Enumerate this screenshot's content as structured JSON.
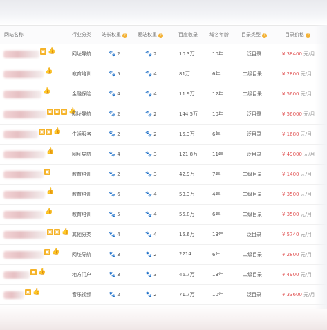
{
  "headers": {
    "site": "网站名称",
    "category": "行业分类",
    "weight1": "站长权重",
    "weight2": "爱站权重",
    "baidu": "百度收录",
    "age": "域名年龄",
    "dirtype": "目录类型",
    "price": "目录价格",
    "question_mark": "?"
  },
  "rows": [
    {
      "category": "网址导航",
      "w1": "2",
      "w2": "2",
      "baidu": "10.3万",
      "age": "10年",
      "dirtype": "泛目录",
      "price": "¥ 38400",
      "unit": " 元/月",
      "site_w": 52,
      "badges": [
        "hot"
      ],
      "thumbs": 1
    },
    {
      "category": "教育培训",
      "w1": "5",
      "w2": "4",
      "baidu": "81万",
      "age": "6年",
      "dirtype": "二级目录",
      "price": "¥ 2800",
      "unit": " 元/月",
      "site_w": 58,
      "badges": [],
      "thumbs": 1
    },
    {
      "category": "金融保险",
      "w1": "4",
      "w2": "4",
      "baidu": "11.9万",
      "age": "12年",
      "dirtype": "二级目录",
      "price": "¥ 5600",
      "unit": " 元/月",
      "site_w": 55,
      "badges": [],
      "thumbs": 1
    },
    {
      "category": "网址导航",
      "w1": "2",
      "w2": "2",
      "baidu": "144.5万",
      "age": "10年",
      "dirtype": "泛目录",
      "price": "¥ 56000",
      "unit": " 元/月",
      "site_w": 62,
      "badges": [
        "hot",
        "hot",
        "hot"
      ],
      "thumbs": 1
    },
    {
      "category": "生活服务",
      "w1": "2",
      "w2": "2",
      "baidu": "15.3万",
      "age": "6年",
      "dirtype": "泛目录",
      "price": "¥ 1680",
      "unit": " 元/月",
      "site_w": 50,
      "badges": [
        "hot",
        "hot"
      ],
      "thumbs": 1
    },
    {
      "category": "网址导航",
      "w1": "4",
      "w2": "3",
      "baidu": "121.8万",
      "age": "11年",
      "dirtype": "泛目录",
      "price": "¥ 49000",
      "unit": " 元/月",
      "site_w": 60,
      "badges": [],
      "thumbs": 1
    },
    {
      "category": "教育培训",
      "w1": "2",
      "w2": "3",
      "baidu": "42.9万",
      "age": "7年",
      "dirtype": "二级目录",
      "price": "¥ 1400",
      "unit": " 元/月",
      "site_w": 58,
      "badges": [
        "hot"
      ],
      "thumbs": 0
    },
    {
      "category": "教育培训",
      "w1": "6",
      "w2": "4",
      "baidu": "53.3万",
      "age": "4年",
      "dirtype": "二级目录",
      "price": "¥ 3500",
      "unit": " 元/月",
      "site_w": 60,
      "badges": [],
      "thumbs": 1
    },
    {
      "category": "教育培训",
      "w1": "5",
      "w2": "4",
      "baidu": "55.8万",
      "age": "6年",
      "dirtype": "二级目录",
      "price": "¥ 3500",
      "unit": " 元/月",
      "site_w": 58,
      "badges": [],
      "thumbs": 1
    },
    {
      "category": "其他分类",
      "w1": "4",
      "w2": "4",
      "baidu": "15.6万",
      "age": "13年",
      "dirtype": "泛目录",
      "price": "¥ 5740",
      "unit": " 元/月",
      "site_w": 62,
      "badges": [
        "hot",
        "hot"
      ],
      "thumbs": 1
    },
    {
      "category": "网址导航",
      "w1": "3",
      "w2": "2",
      "baidu": "2214",
      "age": "6年",
      "dirtype": "二级目录",
      "price": "¥ 2800",
      "unit": " 元/月",
      "site_w": 58,
      "badges": [
        "hot"
      ],
      "thumbs": 1
    },
    {
      "category": "地方门户",
      "w1": "3",
      "w2": "3",
      "baidu": "46.7万",
      "age": "13年",
      "dirtype": "二级目录",
      "price": "¥ 4900",
      "unit": " 元/月",
      "site_w": 38,
      "badges": [
        "hot"
      ],
      "thumbs": 1
    },
    {
      "category": "音乐视频",
      "w1": "2",
      "w2": "2",
      "baidu": "71.7万",
      "age": "10年",
      "dirtype": "泛目录",
      "price": "¥ 33600",
      "unit": " 元/月",
      "site_w": 30,
      "badges": [
        "hot"
      ],
      "thumbs": 1
    }
  ],
  "icons": {
    "badge": "hot-badge-icon",
    "thumb": "thumbs-up-icon",
    "weight": "paw-icon"
  }
}
